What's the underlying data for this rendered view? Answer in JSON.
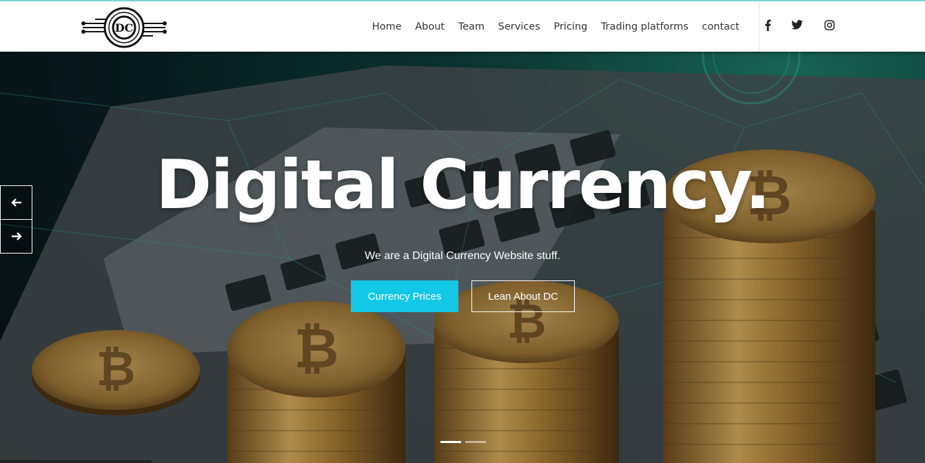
{
  "brand": {
    "logo_text": "DC"
  },
  "nav": {
    "items": [
      "Home",
      "About",
      "Team",
      "Services",
      "Pricing",
      "Trading platforms",
      "contact"
    ]
  },
  "social": {
    "icons": [
      "facebook-icon",
      "twitter-icon",
      "instagram-icon"
    ]
  },
  "hero": {
    "title": "Digital Currency.",
    "subtitle": "We are a Digital Currency Website stuff.",
    "primary_button": "Currency Prices",
    "secondary_button": "Lean About DC",
    "slides_total": 2,
    "active_slide": 1
  },
  "colors": {
    "accent": "#13c8e6",
    "header_bg": "#ffffff",
    "hero_dark": "#0a1f23",
    "hero_teal": "#1e7a67"
  }
}
